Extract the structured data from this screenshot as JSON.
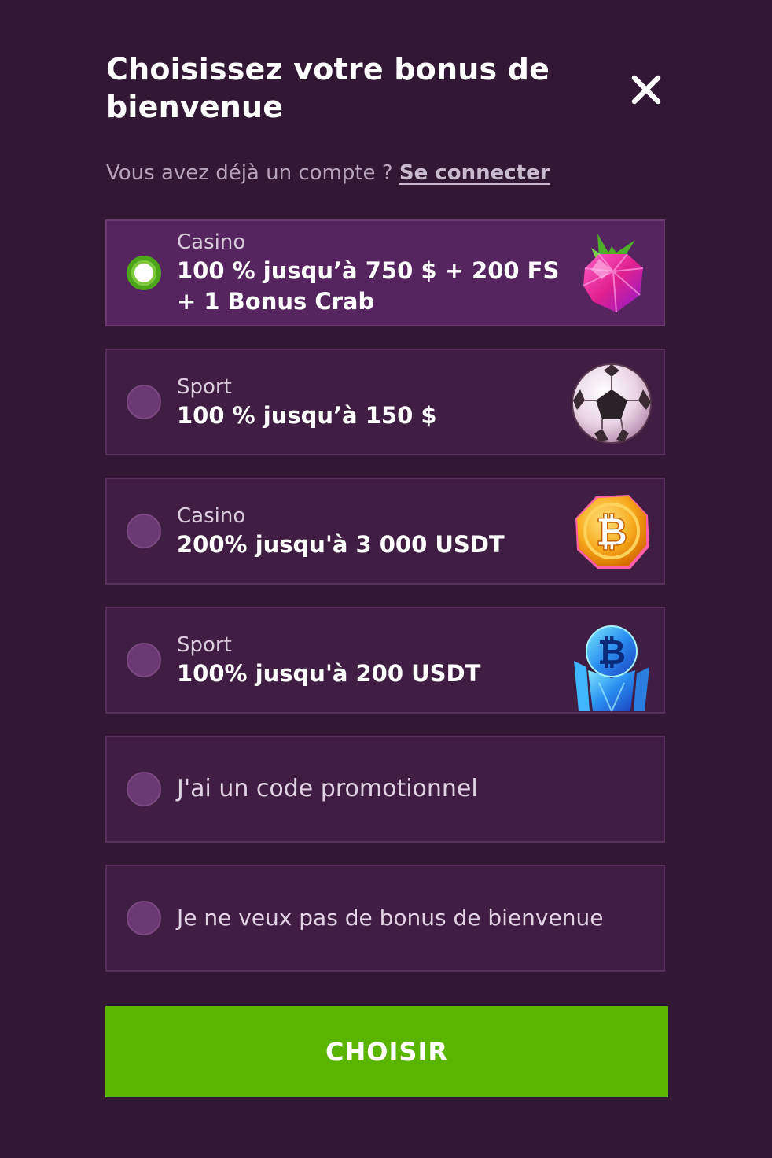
{
  "header": {
    "title": "Choisissez votre bonus de bienvenue",
    "close_icon": "close-icon"
  },
  "account_prompt": {
    "text": "Vous avez déjà un compte ?",
    "login_link": "Se connecter"
  },
  "options": [
    {
      "category": "Casino",
      "line1": "100 % jusqu’à 750 $ + 200 FS",
      "line2": "+ 1 Bonus Crab",
      "selected": true,
      "icon": "raspberry-gem-icon"
    },
    {
      "category": "Sport",
      "line1": "100 % jusqu’à 150 $",
      "selected": false,
      "icon": "soccer-ball-icon"
    },
    {
      "category": "Casino",
      "line1": "200% jusqu'à 3 000 USDT",
      "selected": false,
      "icon": "bitcoin-coin-icon"
    },
    {
      "category": "Sport",
      "line1": "100% jusqu'à 200 USDT",
      "selected": false,
      "icon": "bitcoin-crystal-icon"
    },
    {
      "label": "J'ai un code promotionnel",
      "selected": false
    },
    {
      "label": "Je ne veux pas de bonus de bienvenue",
      "selected": false
    }
  ],
  "submit_label": "CHOISIR",
  "colors": {
    "background": "#321834",
    "option_background": "#401d43",
    "option_selected_background": "#562560",
    "radio_checked": "#4da51a",
    "button": "#5ab500"
  }
}
